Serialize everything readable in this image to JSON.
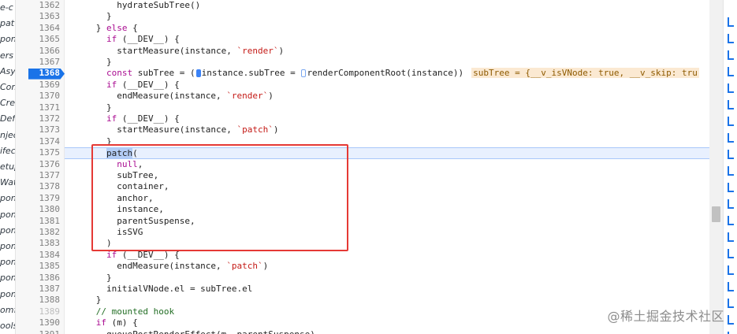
{
  "file_tree": {
    "items": [
      "e-c",
      "pat",
      "pon",
      "ers",
      "Asyn",
      "Com",
      "Crea",
      "Defi",
      "njec",
      "ifec",
      "etup",
      "Watc",
      "pon",
      "pon",
      "pon",
      "pon",
      "pon",
      "pon",
      "pon",
      "omf",
      "ools"
    ]
  },
  "gutter": {
    "line_numbers": [
      "1362",
      "1363",
      "1364",
      "1365",
      "1366",
      "1367",
      "1368",
      "1369",
      "1370",
      "1371",
      "1372",
      "1373",
      "1374",
      "1375",
      "1376",
      "1377",
      "1378",
      "1379",
      "1380",
      "1381",
      "1382",
      "1383",
      "1384",
      "1385",
      "1386",
      "1387",
      "1388",
      "1389",
      "1390",
      "1391"
    ],
    "breakpoint_line": "1368",
    "faded_line": "1389"
  },
  "code": {
    "lines": [
      {
        "parts": [
          {
            "t": "          hydrateSubTree()"
          }
        ]
      },
      {
        "parts": [
          {
            "t": "        }"
          }
        ]
      },
      {
        "parts": [
          {
            "t": "      } "
          },
          {
            "t": "else",
            "c": "kw"
          },
          {
            "t": " {"
          }
        ]
      },
      {
        "parts": [
          {
            "t": "        "
          },
          {
            "t": "if",
            "c": "kw"
          },
          {
            "t": " (__DEV__) {"
          }
        ]
      },
      {
        "parts": [
          {
            "t": "          startMeasure(instance, "
          },
          {
            "t": "`render`",
            "c": "str"
          },
          {
            "t": ")"
          }
        ]
      },
      {
        "parts": [
          {
            "t": "        }"
          }
        ]
      },
      {
        "parts": [
          {
            "t": "        "
          },
          {
            "t": "const",
            "c": "kw"
          },
          {
            "t": " subTree = ("
          },
          {
            "m": "solid"
          },
          {
            "t": "instance.subTree = "
          },
          {
            "m": "outline"
          },
          {
            "t": "renderComponentRoot(instance))"
          },
          {
            "t": "subTree = {__v_isVNode: true, __v_skip: tru",
            "c": "inline-val"
          }
        ]
      },
      {
        "parts": [
          {
            "t": "        "
          },
          {
            "t": "if",
            "c": "kw"
          },
          {
            "t": " (__DEV__) {"
          }
        ]
      },
      {
        "parts": [
          {
            "t": "          endMeasure(instance, "
          },
          {
            "t": "`render`",
            "c": "str"
          },
          {
            "t": ")"
          }
        ]
      },
      {
        "parts": [
          {
            "t": "        }"
          }
        ]
      },
      {
        "parts": [
          {
            "t": "        "
          },
          {
            "t": "if",
            "c": "kw"
          },
          {
            "t": " (__DEV__) {"
          }
        ]
      },
      {
        "parts": [
          {
            "t": "          startMeasure(instance, "
          },
          {
            "t": "`patch`",
            "c": "str"
          },
          {
            "t": ")"
          }
        ]
      },
      {
        "parts": [
          {
            "t": "        }"
          }
        ]
      },
      {
        "parts": [
          {
            "t": "        "
          },
          {
            "t": "patch",
            "c": "sel"
          },
          {
            "t": "("
          }
        ],
        "hl": true
      },
      {
        "parts": [
          {
            "t": "          "
          },
          {
            "t": "null",
            "c": "kw"
          },
          {
            "t": ","
          }
        ]
      },
      {
        "parts": [
          {
            "t": "          subTree,"
          }
        ]
      },
      {
        "parts": [
          {
            "t": "          container,"
          }
        ]
      },
      {
        "parts": [
          {
            "t": "          anchor,"
          }
        ]
      },
      {
        "parts": [
          {
            "t": "          instance,"
          }
        ]
      },
      {
        "parts": [
          {
            "t": "          parentSuspense,"
          }
        ]
      },
      {
        "parts": [
          {
            "t": "          isSVG"
          }
        ]
      },
      {
        "parts": [
          {
            "t": "        )"
          }
        ]
      },
      {
        "parts": [
          {
            "t": "        "
          },
          {
            "t": "if",
            "c": "kw"
          },
          {
            "t": " (__DEV__) {"
          }
        ]
      },
      {
        "parts": [
          {
            "t": "          endMeasure(instance, "
          },
          {
            "t": "`patch`",
            "c": "str"
          },
          {
            "t": ")"
          }
        ]
      },
      {
        "parts": [
          {
            "t": "        }"
          }
        ]
      },
      {
        "parts": [
          {
            "t": "        initialVNode.el = subTree.el"
          }
        ]
      },
      {
        "parts": [
          {
            "t": "      }"
          }
        ]
      },
      {
        "parts": [
          {
            "t": "      "
          },
          {
            "t": "// mounted hook",
            "c": "cm"
          }
        ]
      },
      {
        "parts": [
          {
            "t": "      "
          },
          {
            "t": "if",
            "c": "kw"
          },
          {
            "t": " (m) {"
          }
        ]
      },
      {
        "parts": [
          {
            "t": "        queuePostRenderEffect(m, parentSuspense)"
          }
        ]
      }
    ]
  },
  "watermark": "@稀土掘金技术社区",
  "colors": {
    "accent": "#1a73e8",
    "annotation_box": "#e53935",
    "highlight_line": "#e8f0fe"
  }
}
